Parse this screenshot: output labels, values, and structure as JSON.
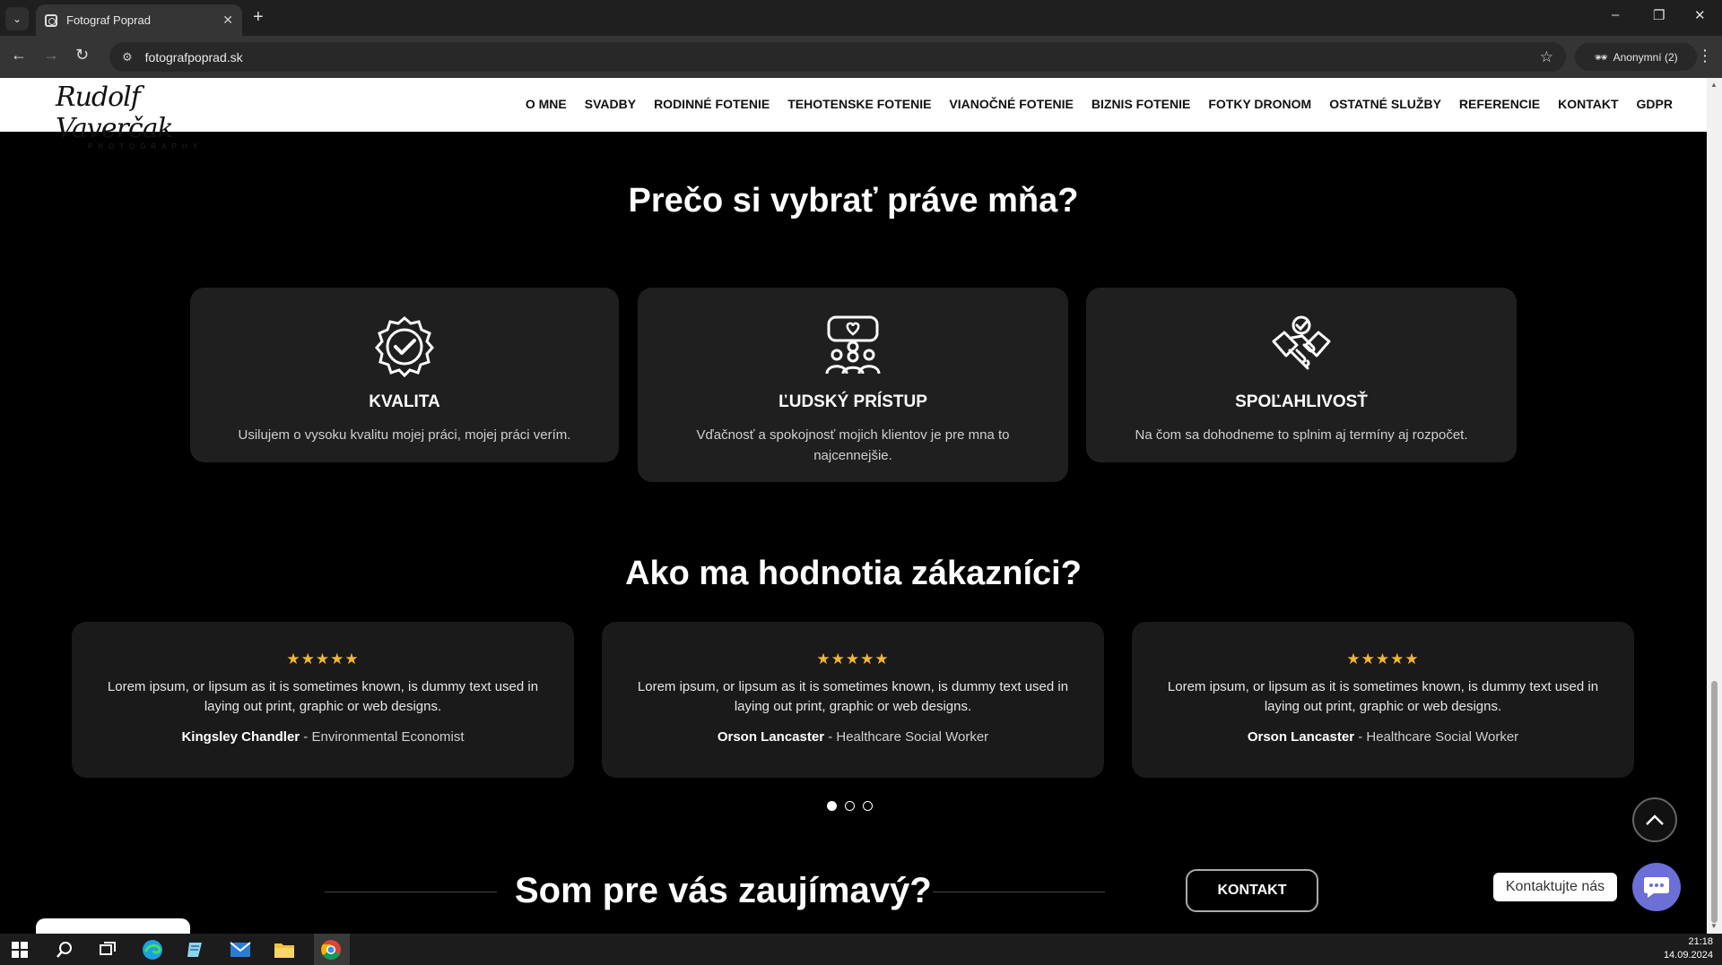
{
  "browser": {
    "tab_title": "Fotograf Poprad",
    "tab_close": "✕",
    "new_tab": "+",
    "url": "fotografpoprad.sk",
    "profile_label": "Anonymní (2)",
    "window_controls": [
      "–",
      "❐",
      "✕"
    ]
  },
  "header": {
    "logo_script": "Rudolf Vaverčak",
    "logo_sub": "PHOTOGRAPHY",
    "nav": [
      "O MNE",
      "SVADBY",
      "RODINNÉ FOTENIE",
      "TEHOTENSKE FOTENIE",
      "VIANOČNÉ FOTENIE",
      "BIZNIS FOTENIE",
      "FOTKY DRONOM",
      "OSTATNÉ SLUŽBY",
      "REFERENCIE",
      "KONTAKT",
      "GDPR"
    ]
  },
  "why": {
    "title": "Prečo si vybrať práve mňa?",
    "cards": [
      {
        "icon": "quality-badge-icon",
        "title": "KVALITA",
        "text": "Usilujem o vysoku kvalitu mojej práci, mojej práci verím."
      },
      {
        "icon": "people-heart-icon",
        "title": "ĽUDSKÝ PRÍSTUP",
        "text": "Vďačnosť a spokojnosť mojich klientov je pre mna to najcennejšie."
      },
      {
        "icon": "handshake-icon",
        "title": "SPOĽAHLIVOSŤ",
        "text": "Na čom sa dohodneme to splnim aj termíny aj rozpočet."
      }
    ]
  },
  "reviews": {
    "title": "Ako ma hodnotia zákazníci?",
    "stars": "★★★★★",
    "items": [
      {
        "text": "Lorem ipsum, or lipsum as it is sometimes known, is dummy text used in laying out print, graphic or web designs.",
        "name": "Kingsley Chandler",
        "role": " - Environmental Economist"
      },
      {
        "text": "Lorem ipsum, or lipsum as it is sometimes known, is dummy text used in laying out print, graphic or web designs.",
        "name": "Orson Lancaster",
        "role": " - Healthcare Social Worker"
      },
      {
        "text": "Lorem ipsum, or lipsum as it is sometimes known, is dummy text used in laying out print, graphic or web designs.",
        "name": "Orson Lancaster",
        "role": " - Healthcare Social Worker"
      }
    ],
    "active_slide": 1,
    "slide_count": 3
  },
  "cta": {
    "title": "Som pre vás zaujímavý?",
    "button": "KONTAKT"
  },
  "widgets": {
    "contact_label": "Kontaktujte nás",
    "chat_color": "#6b6fd6"
  },
  "taskbar": {
    "time": "21:18",
    "date": "14.09.2024"
  }
}
